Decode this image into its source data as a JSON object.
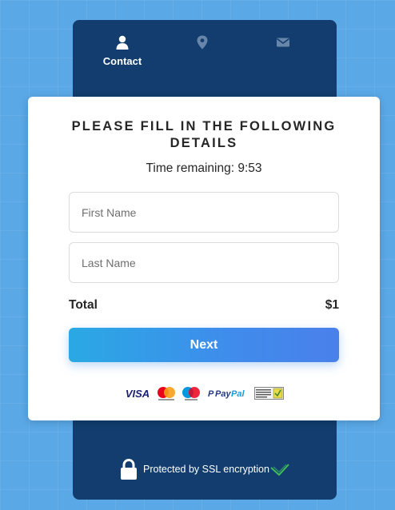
{
  "tabs": [
    {
      "label": "Contact",
      "icon": "user-icon",
      "active": true
    },
    {
      "label": "",
      "icon": "map-pin-icon",
      "active": false
    },
    {
      "label": "",
      "icon": "envelope-icon",
      "active": false
    }
  ],
  "form": {
    "title": "PLEASE FILL IN THE FOLLOWING DETAILS",
    "timer_label": "Time remaining: 9:53",
    "first_name_placeholder": "First Name",
    "first_name_value": "",
    "last_name_placeholder": "Last Name",
    "last_name_value": "",
    "total_label": "Total",
    "total_value": "$1",
    "next_label": "Next"
  },
  "payment_methods": [
    {
      "name": "Visa",
      "icon": "visa-logo"
    },
    {
      "name": "Mastercard",
      "icon": "mastercard-logo"
    },
    {
      "name": "Maestro",
      "icon": "maestro-logo"
    },
    {
      "name": "PayPal",
      "icon": "paypal-logo"
    },
    {
      "name": "SSL Secure Connection",
      "icon": "ssl-badge"
    }
  ],
  "footer": {
    "ssl_text": "Protected by SSL encryption"
  },
  "colors": {
    "background": "#5aa8e6",
    "panel": "#123d6e",
    "button_start": "#2aa9e4",
    "button_end": "#4a80ea",
    "check": "#3fbf5a"
  }
}
